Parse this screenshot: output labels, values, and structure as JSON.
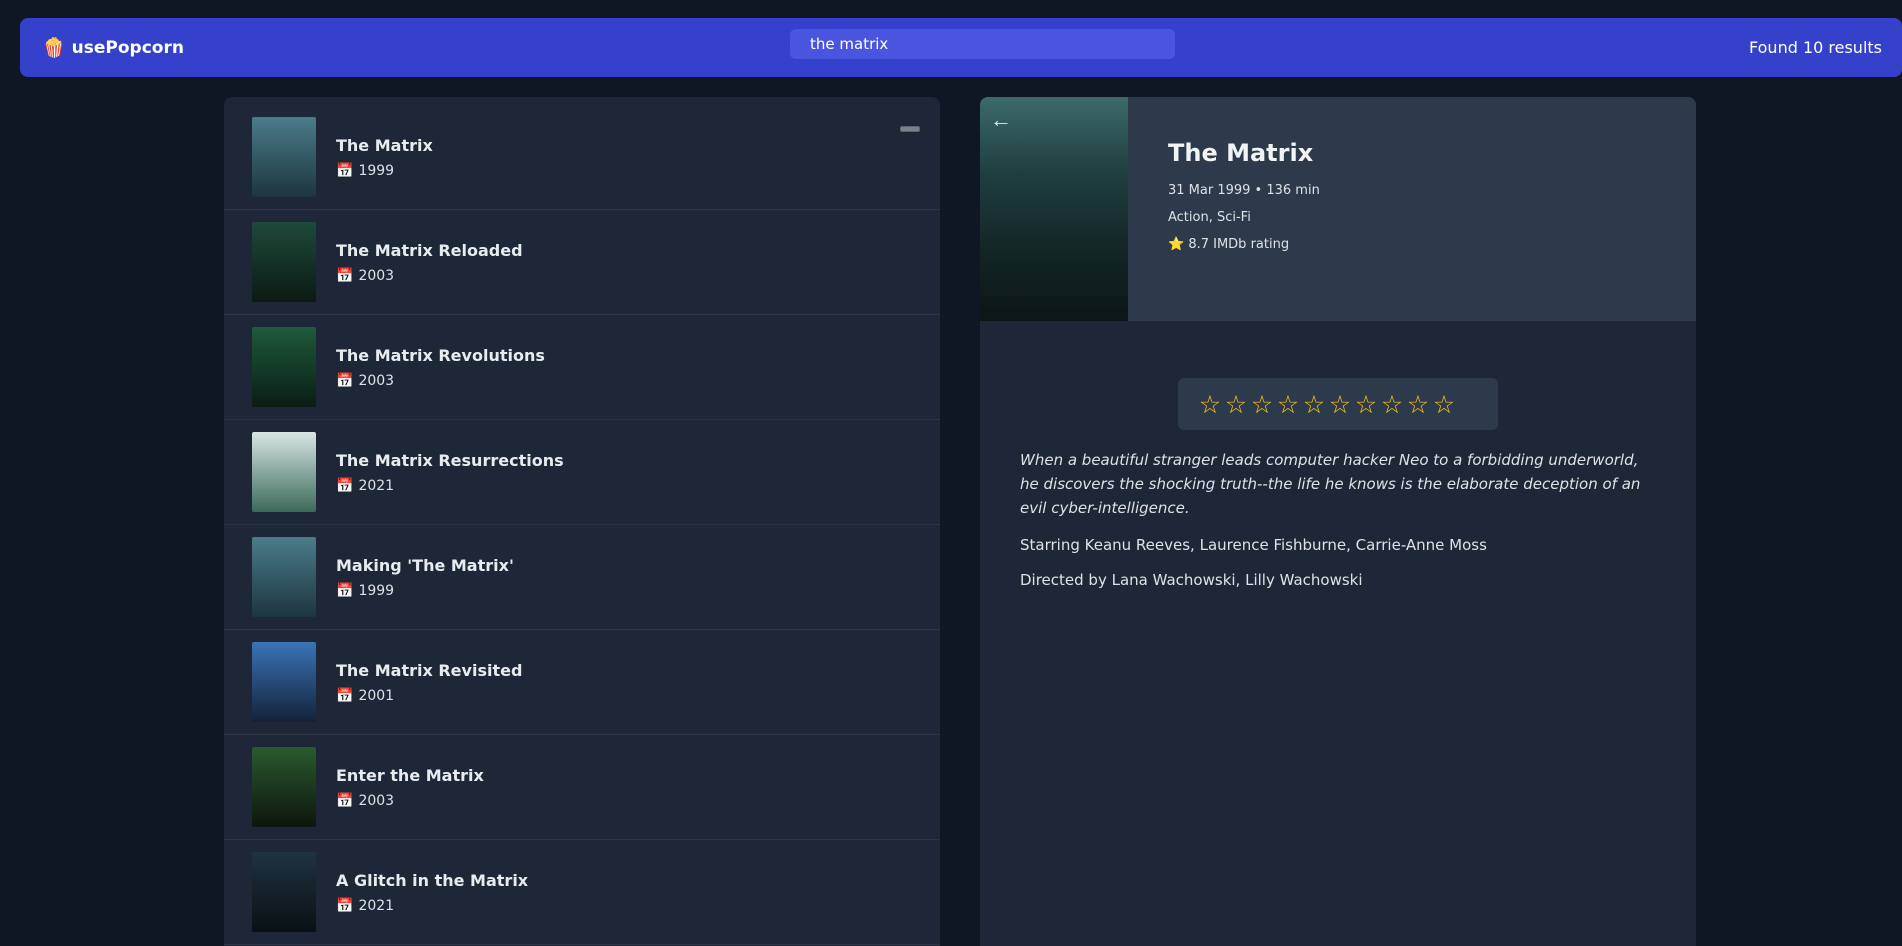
{
  "navbar": {
    "logo_icon": "🍿",
    "logo_text": "usePopcorn",
    "search_value": "the matrix",
    "results_text": "Found 10 results"
  },
  "list_toggle": "–",
  "movies": [
    {
      "title": "The Matrix",
      "year": "1999",
      "poster_colors": [
        "#4b7c8a",
        "#1d3540"
      ]
    },
    {
      "title": "The Matrix Reloaded",
      "year": "2003",
      "poster_colors": [
        "#1e4a3a",
        "#0b1a14"
      ]
    },
    {
      "title": "The Matrix Revolutions",
      "year": "2003",
      "poster_colors": [
        "#1f5a3c",
        "#0a1d14"
      ]
    },
    {
      "title": "The Matrix Resurrections",
      "year": "2021",
      "poster_colors": [
        "#d8e6e4",
        "#3b6a5a"
      ]
    },
    {
      "title": "Making 'The Matrix'",
      "year": "1999",
      "poster_colors": [
        "#4b7c8a",
        "#1d3540"
      ]
    },
    {
      "title": "The Matrix Revisited",
      "year": "2001",
      "poster_colors": [
        "#3a74b8",
        "#132238"
      ]
    },
    {
      "title": "Enter the Matrix",
      "year": "2003",
      "poster_colors": [
        "#2b5a2f",
        "#0c160c"
      ]
    },
    {
      "title": "A Glitch in the Matrix",
      "year": "2021",
      "poster_colors": [
        "#1e3340",
        "#0a1014"
      ]
    }
  ],
  "year_icon": "📅",
  "details": {
    "back_icon": "←",
    "title": "The Matrix",
    "released_runtime": "31 Mar 1999 • 136 min",
    "genre": "Action, Sci-Fi",
    "rating": "⭐ 8.7 IMDb rating",
    "stars": [
      "☆",
      "☆",
      "☆",
      "☆",
      "☆",
      "☆",
      "☆",
      "☆",
      "☆",
      "☆"
    ],
    "plot": "When a beautiful stranger leads computer hacker Neo to a forbidding underworld, he discovers the shocking truth--the life he knows is the elaborate deception of an evil cyber-intelligence.",
    "cast": "Starring Keanu Reeves, Laurence Fishburne, Carrie-Anne Moss",
    "director": "Directed by Lana Wachowski, Lilly Wachowski"
  }
}
